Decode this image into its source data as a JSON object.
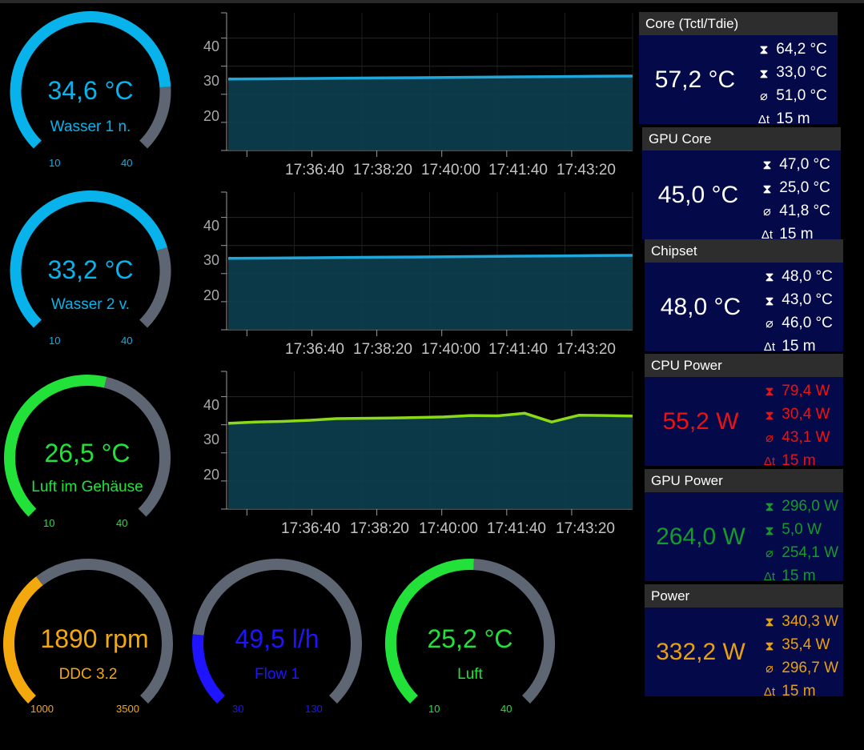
{
  "colors": {
    "track": "#5f6673",
    "cyan": "#08b3ec",
    "green": "#22e23a",
    "orange": "#f3a90d",
    "blue": "#1e14ff",
    "line_cyan": "#1fa7db",
    "line_lime": "#8cd81a",
    "fill": "#0d3f50",
    "panel_bg": "#040a49",
    "panel_head": "#2d2d2d"
  },
  "gauges": [
    {
      "value": "34,6 °C",
      "label": "Wasser 1 n.",
      "min": "10",
      "max": "40",
      "fraction": 0.82,
      "color": "#08b3ec"
    },
    {
      "value": "33,2 °C",
      "label": "Wasser 2 v.",
      "min": "10",
      "max": "40",
      "fraction": 0.77,
      "color": "#08b3ec"
    },
    {
      "value": "26,5 °C",
      "label": "Luft im Gehäuse",
      "min": "10",
      "max": "40",
      "fraction": 0.55,
      "color": "#22e23a"
    },
    {
      "value": "1890 rpm",
      "label": "DDC 3.2",
      "min": "1000",
      "max": "3500",
      "fraction": 0.36,
      "color": "#f3a90d"
    },
    {
      "value": "49,5 l/h",
      "label": "Flow 1",
      "min": "30",
      "max": "130",
      "fraction": 0.19,
      "color": "#1e14ff"
    },
    {
      "value": "25,2 °C",
      "label": "Luft",
      "min": "10",
      "max": "40",
      "fraction": 0.51,
      "color": "#22e23a"
    }
  ],
  "charts": [
    {
      "y_ticks": [
        "40",
        "30",
        "20"
      ],
      "x_ticks": [
        "17:36:40",
        "17:38:20",
        "17:40:00",
        "17:41:40",
        "17:43:20"
      ],
      "ylim": [
        0,
        49
      ],
      "line_color": "#1fa7db",
      "series": [
        25.4,
        25.5,
        25.6,
        25.7,
        25.8,
        25.9,
        26.0,
        26.1,
        26.2,
        26.3,
        26.4,
        26.5
      ]
    },
    {
      "y_ticks": [
        "40",
        "30",
        "20"
      ],
      "x_ticks": [
        "17:36:40",
        "17:38:20",
        "17:40:00",
        "17:41:40",
        "17:43:20"
      ],
      "ylim": [
        0,
        49
      ],
      "line_color": "#1fa7db",
      "series": [
        25.4,
        25.5,
        25.6,
        25.7,
        25.8,
        25.9,
        26.0,
        26.1,
        26.2,
        26.3,
        26.4,
        26.5
      ]
    },
    {
      "y_ticks": [
        "40",
        "30",
        "20"
      ],
      "x_ticks": [
        "17:36:40",
        "17:38:20",
        "17:40:00",
        "17:41:40",
        "17:43:20"
      ],
      "ylim": [
        0,
        49
      ],
      "line_color": "#8cd81a",
      "series": [
        30.5,
        31.0,
        31.2,
        31.6,
        32.2,
        32.3,
        32.4,
        32.6,
        32.8,
        33.3,
        33.2,
        34.1,
        31.0,
        33.4,
        33.3,
        33.1
      ]
    }
  ],
  "panels": [
    {
      "title": "Core (Tctl/Tdie)",
      "value": "57,2 °C",
      "color": "#ffffff",
      "max": "64,2 °C",
      "min": "33,0 °C",
      "avg": "51,0 °C",
      "dt": "15 m"
    },
    {
      "title": "GPU Core",
      "value": "45,0 °C",
      "color": "#ffffff",
      "max": "47,0 °C",
      "min": "25,0 °C",
      "avg": "41,8 °C",
      "dt": "15 m"
    },
    {
      "title": "Chipset",
      "value": "48,0 °C",
      "color": "#ffffff",
      "max": "48,0 °C",
      "min": "43,0 °C",
      "avg": "46,0 °C",
      "dt": "15 m"
    },
    {
      "title": "CPU Power",
      "value": "55,2 W",
      "color": "#ee1111",
      "max": "79,4 W",
      "min": "30,4 W",
      "avg": "43,1 W",
      "dt": "15 m"
    },
    {
      "title": "GPU Power",
      "value": "264,0 W",
      "color": "#169a2a",
      "max": "296,0 W",
      "min": "5,0 W",
      "avg": "254,1 W",
      "dt": "15 m"
    },
    {
      "title": "Power",
      "value": "332,2 W",
      "color": "#e8a10e",
      "max": "340,3 W",
      "min": "35,4 W",
      "avg": "296,7 W",
      "dt": "15 m"
    }
  ],
  "icons": {
    "max": "max-hourglass-icon",
    "min": "min-hourglass-icon",
    "avg": "average-icon",
    "delta": "delta-t-icon"
  },
  "glyphs": {
    "max": "⧗",
    "min": "⧗",
    "avg": "⌀",
    "dt": "Δt"
  }
}
